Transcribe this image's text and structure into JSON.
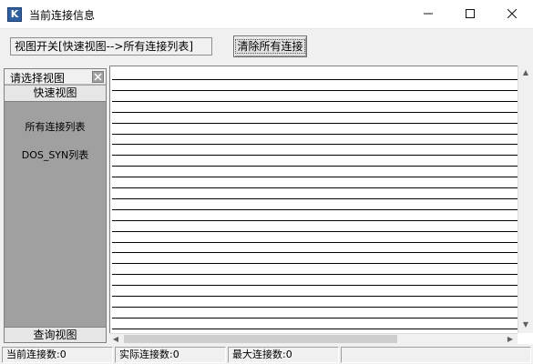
{
  "window": {
    "title": "当前连接信息",
    "app_icon_letter": "K"
  },
  "toolbar": {
    "view_switch_label": "视图开关[快速视图-->所有连接列表]",
    "clear_button_label": "清除所有连接"
  },
  "left_panel": {
    "header": "请选择视图",
    "quick_view": "快速视图",
    "items": [
      {
        "label": "所有连接列表"
      },
      {
        "label": "DOS_SYN列表"
      }
    ],
    "query_view": "查询视图"
  },
  "main_list": {
    "rows": 24
  },
  "status_bar": {
    "current_connections": "当前连接数:0",
    "actual_connections": "实际连接数:0",
    "max_connections": "最大连接数:0"
  },
  "icons": {
    "app": "app-logo-icon",
    "minimize": "minimize-icon",
    "maximize": "maximize-icon",
    "close": "close-icon",
    "panel_close": "panel-close-icon"
  }
}
